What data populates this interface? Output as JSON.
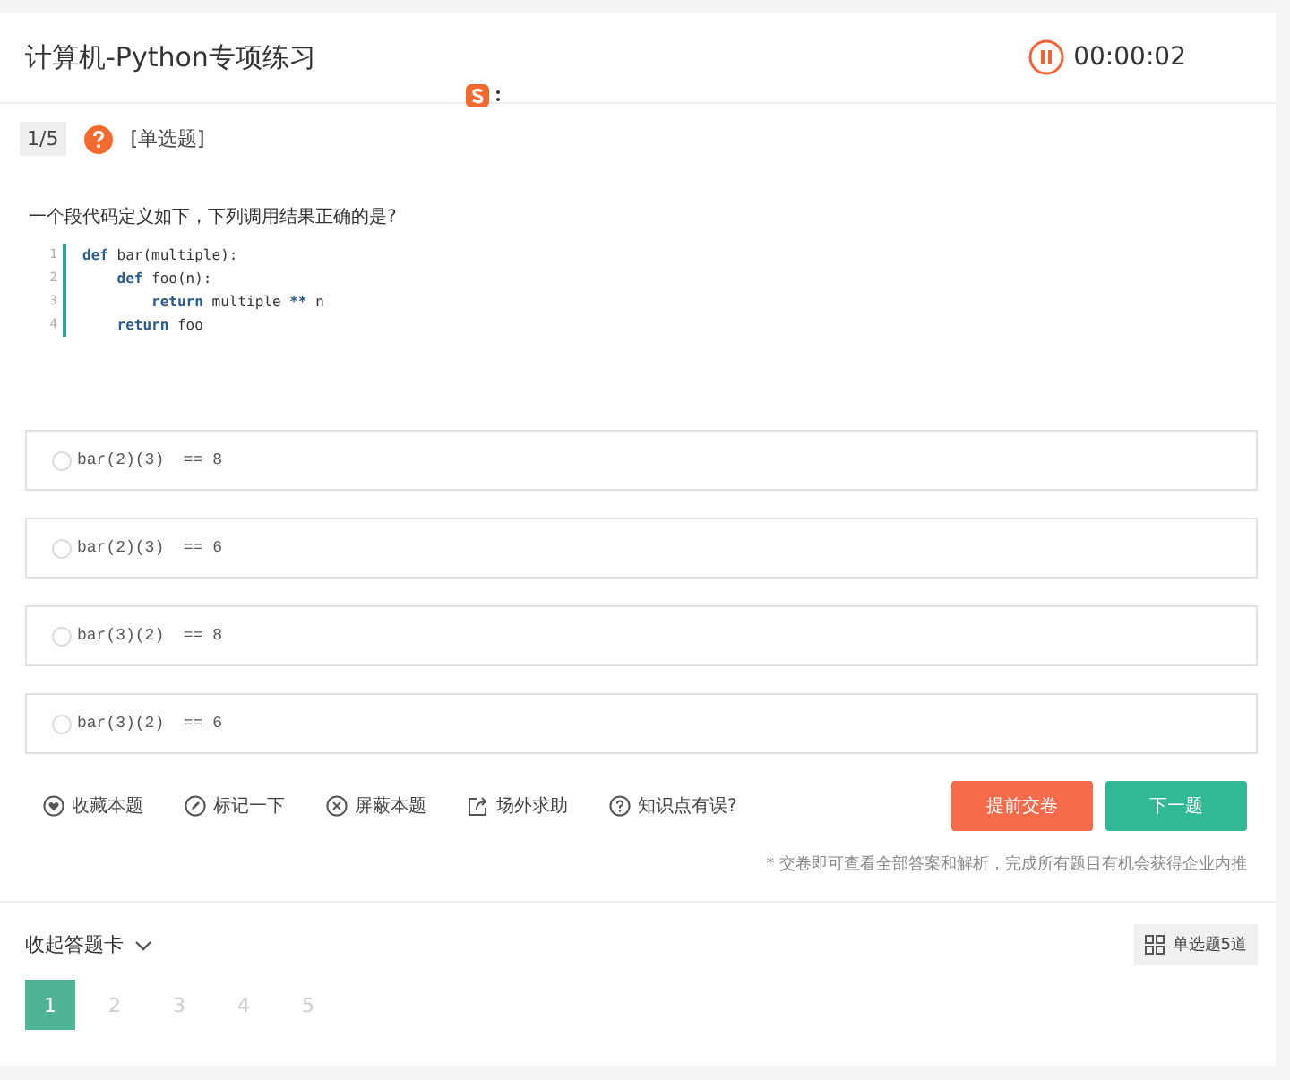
{
  "header": {
    "title": "计算机-Python专项练习",
    "timer": "00:00:02"
  },
  "question": {
    "index": "1/5",
    "type": "[单选题]",
    "text": "一个段代码定义如下，下列调用结果正确的是?",
    "code": [
      {
        "num": "1",
        "tokens": [
          {
            "kind": "kw",
            "text": "def"
          },
          {
            "kind": "plain",
            "text": " bar(multiple):"
          }
        ]
      },
      {
        "num": "2",
        "tokens": [
          {
            "kind": "kw",
            "text": "    def"
          },
          {
            "kind": "plain",
            "text": " foo(n):"
          }
        ]
      },
      {
        "num": "3",
        "tokens": [
          {
            "kind": "kw",
            "text": "        return"
          },
          {
            "kind": "plain",
            "text": " multiple "
          },
          {
            "kind": "kw",
            "text": "**"
          },
          {
            "kind": "plain",
            "text": " n"
          }
        ]
      },
      {
        "num": "4",
        "tokens": [
          {
            "kind": "kw",
            "text": "    return"
          },
          {
            "kind": "plain",
            "text": " foo"
          }
        ]
      }
    ]
  },
  "options": [
    {
      "text": "bar(2)(3)  == 8",
      "selected": false
    },
    {
      "text": "bar(2)(3)  == 6",
      "selected": false
    },
    {
      "text": "bar(3)(2)  == 8",
      "selected": false
    },
    {
      "text": "bar(3)(2)  == 6",
      "selected": false
    }
  ],
  "actions": [
    {
      "kind": "heart",
      "label": "收藏本题"
    },
    {
      "kind": "pen",
      "label": "标记一下"
    },
    {
      "kind": "block",
      "label": "屏蔽本题"
    },
    {
      "kind": "share",
      "label": "场外求助"
    },
    {
      "kind": "help",
      "label": "知识点有误?"
    }
  ],
  "buttons": [
    {
      "kind": "submit",
      "label": "提前交卷"
    },
    {
      "kind": "next",
      "label": "下一题"
    }
  ],
  "note": "* 交卷即可查看全部答案和解析，完成所有题目有机会获得企业内推",
  "answer_card": {
    "toggle": "收起答题卡",
    "summary": "单选题5道",
    "numbers": [
      {
        "label": "1",
        "selected": true
      },
      {
        "label": "2",
        "selected": false
      },
      {
        "label": "3",
        "selected": false
      },
      {
        "label": "4",
        "selected": false
      },
      {
        "label": "5",
        "selected": false
      }
    ]
  }
}
